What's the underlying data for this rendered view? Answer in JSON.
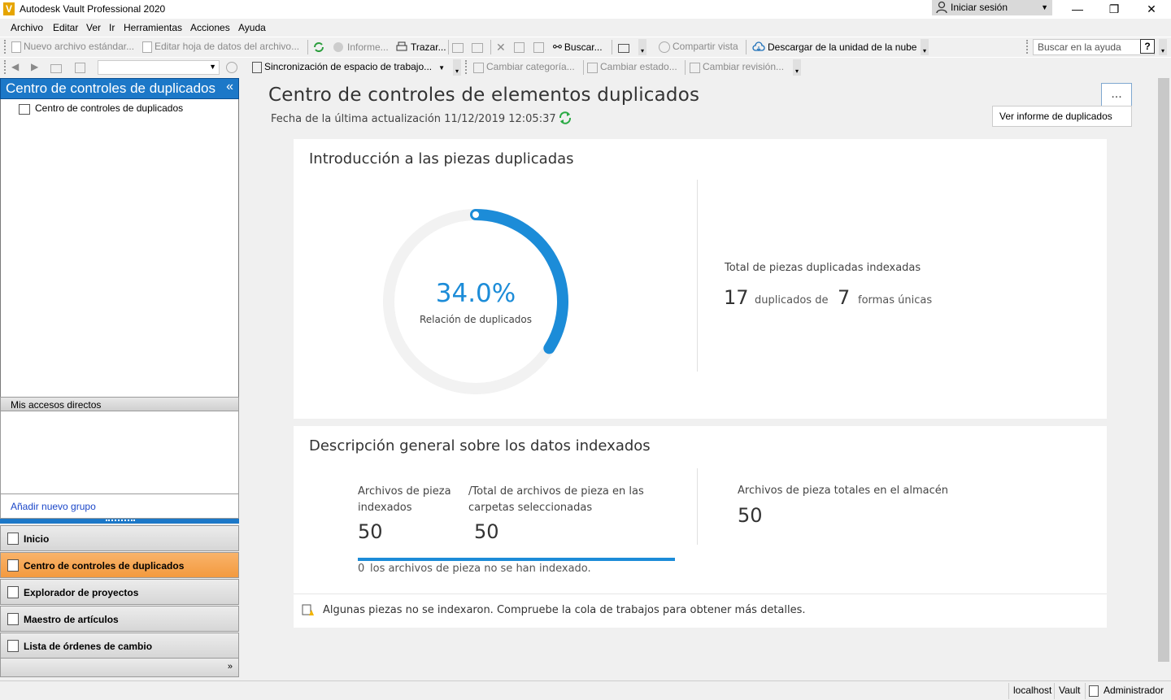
{
  "app": {
    "title": "Autodesk Vault Professional 2020",
    "logo_letter": "V"
  },
  "signin": {
    "label": "Iniciar sesión"
  },
  "window_controls": {
    "minimize": "—",
    "restore": "❐",
    "close": "✕"
  },
  "menu": [
    "Archivo",
    "Editar",
    "Ver",
    "Ir",
    "Herramientas",
    "Acciones",
    "Ayuda"
  ],
  "toolbar1": {
    "new_file": "Nuevo archivo estándar...",
    "edit_datasheet": "Editar hoja de datos del archivo...",
    "report": "Informe...",
    "plot": "Trazar...",
    "search": "Buscar...",
    "share_view": "Compartir vista",
    "cloud_download": "Descargar de la unidad de la nube",
    "help_search_placeholder": "Buscar en la ayuda",
    "help_button": "?"
  },
  "toolbar2": {
    "sync": "Sincronización de espacio de trabajo...",
    "change_category": "Cambiar categoría...",
    "change_state": "Cambiar estado...",
    "change_revision": "Cambiar revisión..."
  },
  "left_panel": {
    "header": "Centro de controles de duplicados",
    "collapse": "«",
    "tree_node": "Centro de controles de duplicados",
    "shortcuts_header": "Mis accesos directos",
    "add_group": "Añadir nuevo grupo",
    "nav_buttons": [
      {
        "label": "Inicio",
        "active": false
      },
      {
        "label": "Centro de controles de duplicados",
        "active": true
      },
      {
        "label": "Explorador de proyectos",
        "active": false
      },
      {
        "label": "Maestro de artículos",
        "active": false
      },
      {
        "label": "Lista de órdenes de cambio",
        "active": false
      }
    ],
    "nav_more": "»"
  },
  "main": {
    "title": "Centro de controles de elementos duplicados",
    "last_update": "Fecha de la última actualización 11/12/2019 12:05:37",
    "more_button": "...",
    "tooltip": "Ver informe de duplicados"
  },
  "intro_card": {
    "title": "Introducción a las piezas duplicadas",
    "ratio_value": "34.0%",
    "ratio_fraction": 0.34,
    "ratio_label": "Relación de duplicados",
    "total_label": "Total de piezas duplicadas indexadas",
    "duplicates": "17",
    "duplicates_label": "duplicados de",
    "unique": "7",
    "unique_label": "formas únicas"
  },
  "overview_card": {
    "title": "Descripción general sobre los datos indexados",
    "indexed_label": "Archivos de pieza indexados",
    "indexed_value": "50",
    "total_selected_label": "/Total de archivos de pieza en las carpetas seleccionadas",
    "total_selected_value": "50",
    "index_progress": 1.0,
    "not_indexed_count": "0",
    "not_indexed_label": "los archivos de pieza no se han indexado.",
    "vault_total_label": "Archivos de pieza totales en el almacén",
    "vault_total_value": "50",
    "warning": "Algunas piezas no se indexaron. Compruebe la cola de trabajos para obtener más detalles."
  },
  "statusbar": {
    "server": "localhost",
    "vault": "Vault",
    "user": "Administrador"
  },
  "colors": {
    "accent": "#1c8cd8",
    "header_blue": "#1c78c8",
    "active_nav": "#f39a3f"
  }
}
